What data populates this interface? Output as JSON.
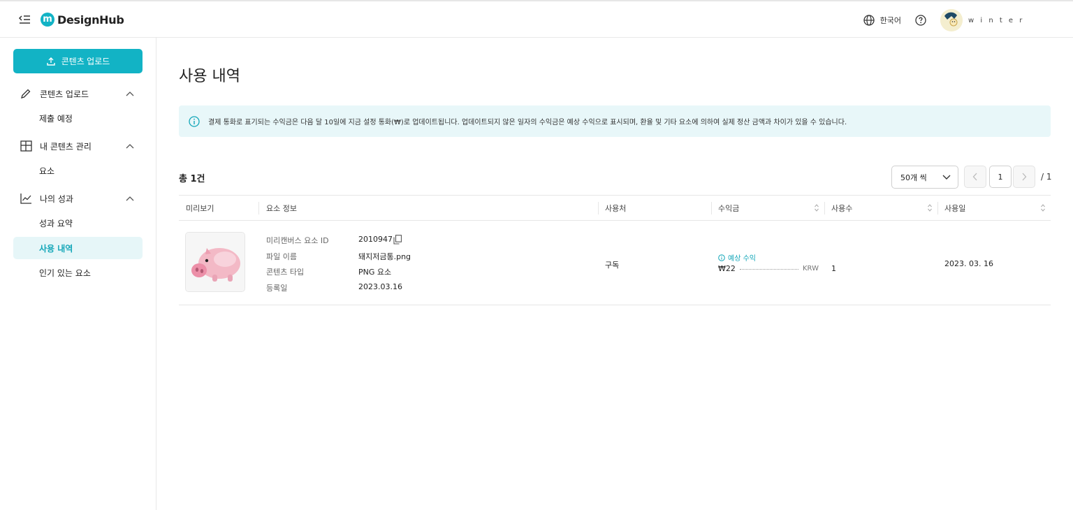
{
  "header": {
    "logo_mark": "m",
    "logo_text": "DesignHub",
    "language": "한국어",
    "username": "w i n t e r"
  },
  "sidebar": {
    "upload_button": "콘텐츠 업로드",
    "groups": [
      {
        "label": "콘텐츠 업로드",
        "icon": "pencil-icon",
        "items": [
          "제출 예정"
        ]
      },
      {
        "label": "내 콘텐츠 관리",
        "icon": "grid-icon",
        "items": [
          "요소"
        ]
      },
      {
        "label": "나의 성과",
        "icon": "chart-icon",
        "items": [
          "성과 요약",
          "사용 내역",
          "인기 있는 요소"
        ]
      }
    ],
    "active_item": "사용 내역"
  },
  "main": {
    "title": "사용 내역",
    "notice": "결제 통화로 표기되는 수익금은 다음 달 10일에 지금 설정 통화(₩)로 업데이트됩니다. 업데이트되지 않은 일자의 수익금은 예상 수익으로 표시되며, 환율 및 기타 요소에 의하여 실제 정산 금액과 차이가 있을 수 있습니다.",
    "total": "총 1건",
    "per_page": "50개 씩",
    "pagination": {
      "current": "1",
      "total": "/ 1"
    },
    "table": {
      "columns": [
        "미리보기",
        "요소 정보",
        "사용처",
        "수익금",
        "사용수",
        "사용일"
      ],
      "rows": [
        {
          "info_labels": [
            "미리캔버스 요소 ID",
            "파일 이름",
            "콘텐츠 타입",
            "등록일"
          ],
          "element_id": "2010947",
          "file_name": "돼지저금통.png",
          "content_type": "PNG 요소",
          "registered": "2023.03.16",
          "usage": "구독",
          "revenue_badge": "예상 수익",
          "revenue_amount": "₩22",
          "revenue_currency": "KRW",
          "count": "1",
          "date": "2023. 03. 16"
        }
      ]
    }
  },
  "colors": {
    "accent": "#12b3c5",
    "notice_bg": "#e8f7f9",
    "active_bg": "#e6f6f8"
  }
}
